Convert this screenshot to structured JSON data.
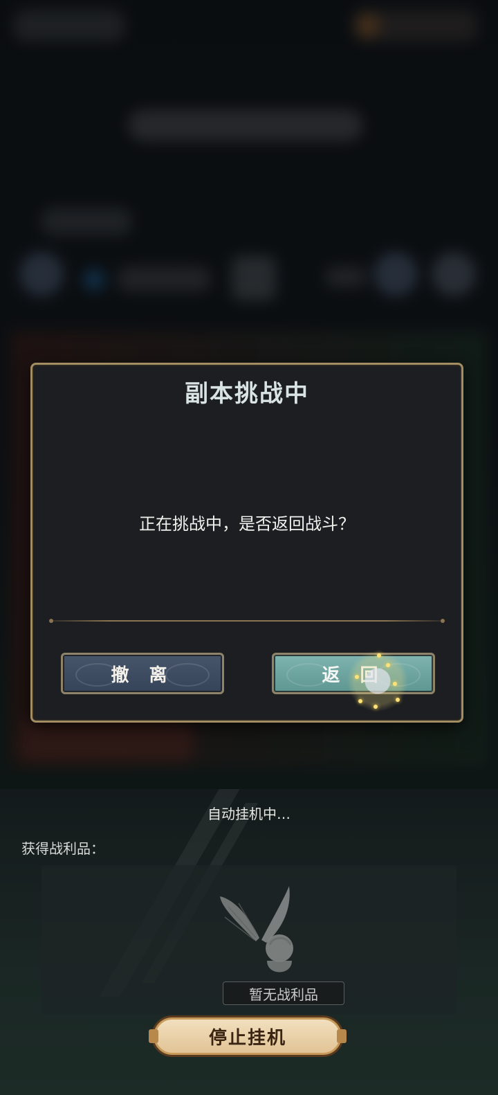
{
  "dialog": {
    "title": "副本挑战中",
    "message": "正在挑战中，是否返回战斗？",
    "retreat_label": "撤 离",
    "return_label": "返 回"
  },
  "auto_battle": {
    "status": "自动挂机中…",
    "loot_label": "获得战利品：",
    "no_loot_text": "暂无战利品",
    "stop_button_label": "停止挂机"
  },
  "colors": {
    "dialog_border": "#a38d63",
    "retreat_button": "#3f4d62",
    "return_button": "#6fa6a1",
    "stop_button": "#e9d3ab"
  },
  "icons": {
    "loot_placeholder": "fairy-icon"
  }
}
